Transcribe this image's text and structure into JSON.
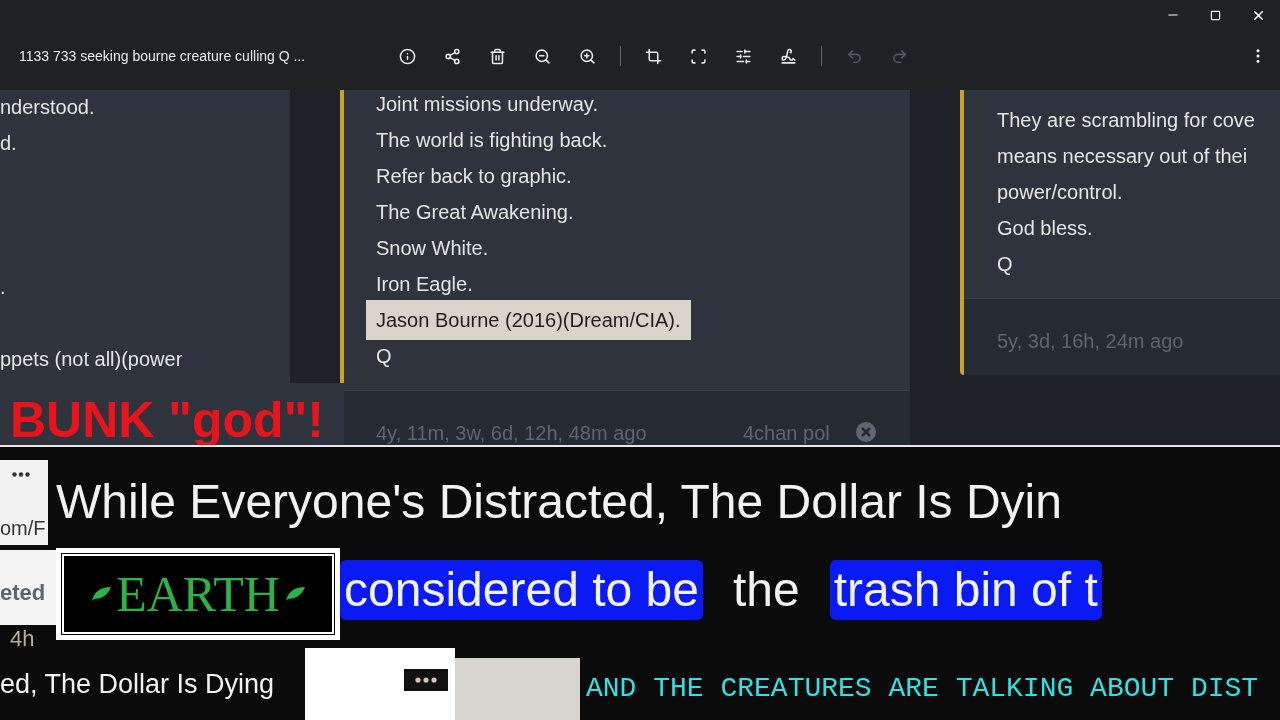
{
  "window": {
    "title": "1133 733 seeking bourne creature culling Q ..."
  },
  "toolbar": {
    "tools": [
      {
        "kind": "info",
        "disabled": false
      },
      {
        "kind": "share",
        "disabled": false
      },
      {
        "kind": "delete",
        "disabled": false
      },
      {
        "kind": "zoom-out",
        "disabled": false
      },
      {
        "kind": "zoom-in",
        "disabled": false
      },
      {
        "kind": "crop",
        "disabled": false
      },
      {
        "kind": "select",
        "disabled": false
      },
      {
        "kind": "adjust",
        "disabled": false
      },
      {
        "kind": "draw",
        "disabled": false
      },
      {
        "kind": "undo",
        "disabled": true
      },
      {
        "kind": "redo",
        "disabled": true
      }
    ]
  },
  "collage": {
    "post_left": {
      "lines": [
        "nderstood.",
        "d.",
        ".",
        "ppets (not all)(power"
      ]
    },
    "post_middle": {
      "lines": [
        {
          "text": "Joint missions underway.",
          "highlighted": false
        },
        {
          "text": "The world is fighting back.",
          "highlighted": false
        },
        {
          "text": "Refer back to graphic.",
          "highlighted": false
        },
        {
          "text": "The Great Awakening.",
          "highlighted": false
        },
        {
          "text": "Snow White.",
          "highlighted": false
        },
        {
          "text": "Iron Eagle.",
          "highlighted": false
        },
        {
          "text": "Jason Bourne (2016)(Dream/CIA).",
          "highlighted": true
        },
        {
          "text": "Q",
          "highlighted": false
        }
      ],
      "time": "4y, 11m, 3w, 6d, 12h, 48m ago",
      "source": "4chan pol"
    },
    "post_right": {
      "lines": [
        "They are scrambling for cove",
        "means necessary out of thei",
        "power/control.",
        "God bless.",
        "Q"
      ],
      "time": "5y, 3d, 16h, 24m ago"
    },
    "red_caption": "BUNK \"god\"!",
    "headline": "While Everyone's Distracted, The Dollar Is Dyin",
    "url_fragment": "om/F",
    "label_fragment": "eted",
    "age": "4h",
    "earth": "EARTH",
    "phrase": [
      {
        "text": "considered to be",
        "marked": true
      },
      {
        "text": "the",
        "marked": false
      },
      {
        "text": "trash bin of t",
        "marked": true
      }
    ],
    "headline_small": "ed, The Dollar Is Dying",
    "creatures": "AND THE CREATURES ARE TALKING ABOUT DIST"
  }
}
